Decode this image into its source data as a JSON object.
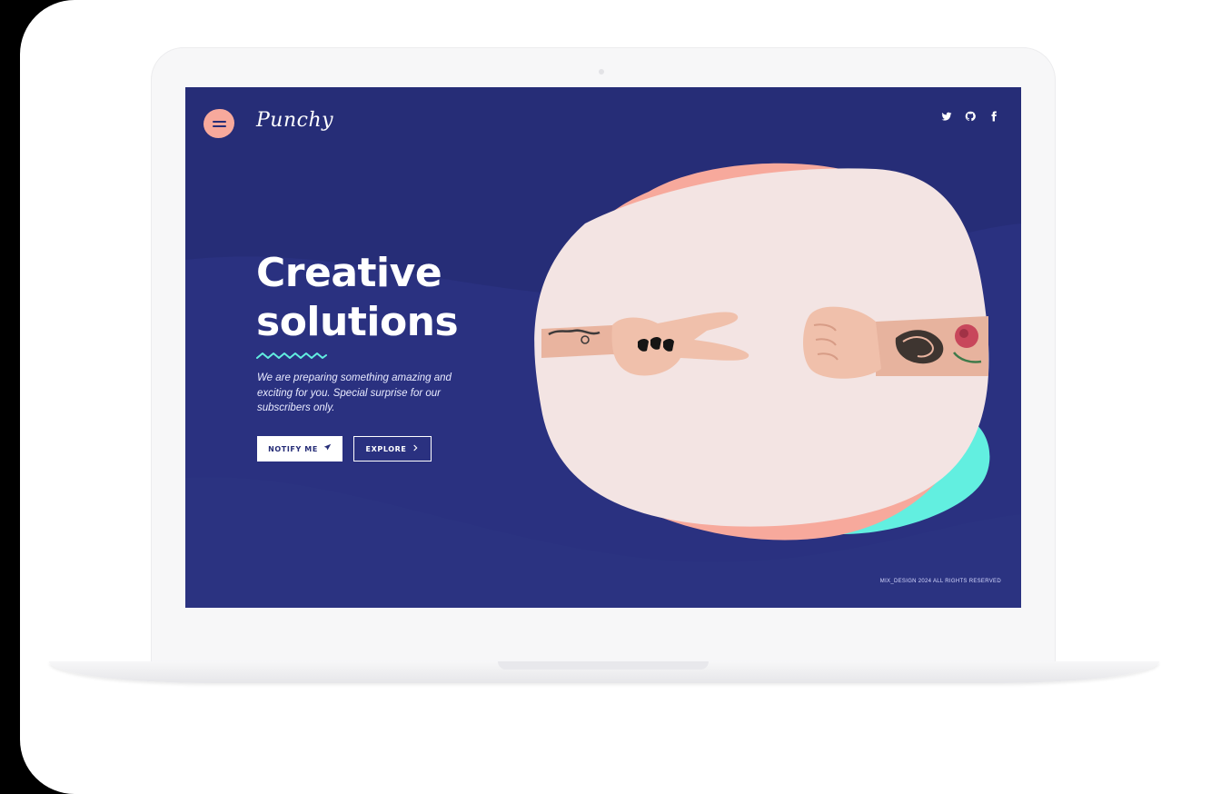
{
  "brand": {
    "logo_text": "Punchy"
  },
  "social": [
    "twitter-icon",
    "github-icon",
    "facebook-icon"
  ],
  "hero": {
    "headline_line1": "Creative",
    "headline_line2": "solutions",
    "description": "We are preparing something amazing and exciting for you. Special surprise for our subscribers only."
  },
  "buttons": {
    "notify_label": "NOTIFY ME",
    "explore_label": "EXPLORE"
  },
  "footer": {
    "copyright": "MIX_DESIGN 2024 ALL RIGHTS RESERVED"
  },
  "colors": {
    "background": "#262d77",
    "accent_pink": "#f7a99c",
    "accent_teal": "#62efe0",
    "blob_cream": "#f3e4e3",
    "frame": "#f7f7f8"
  }
}
